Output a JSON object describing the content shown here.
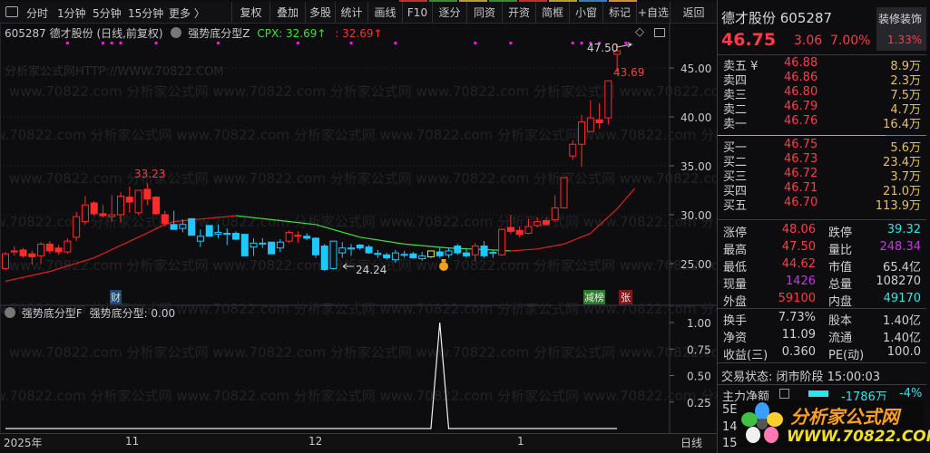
{
  "toolbar": {
    "tabs": [
      "分时",
      "1分钟",
      "5分钟",
      "15分钟",
      "更多 〉"
    ],
    "buttons": [
      "复权",
      "叠加",
      "多股",
      "统计",
      "画线",
      "F10",
      "逐分",
      "同资",
      "开资",
      "简框",
      "小窗",
      "标记",
      "+自选",
      "返回"
    ]
  },
  "chart_header": {
    "code_name": "605287 德才股份 (日线,前复权)",
    "indicator": "强势底分型Z",
    "cpx_label": "CPX: 32.69↑",
    "cpx_value": ": 32.69↑"
  },
  "watermark": {
    "main": "分析家公式网HTTP://WWW.70822.COM",
    "repeat": "www.70822.com 分析家公式网"
  },
  "price_axis": [
    "45.00",
    "40.00",
    "35.00",
    "30.00",
    "25.00"
  ],
  "price_ticks": [
    45,
    40,
    35,
    30,
    25
  ],
  "annotations": {
    "high_label": "33.23",
    "low_label": "24.24",
    "peak_label": "47.50",
    "close_label": "43.69"
  },
  "badges": {
    "cai": "财",
    "jianbang": "减榜",
    "zhang": "张"
  },
  "indicator_panel": {
    "label": "强势底分型F",
    "value_label": "强势底分型: 0.00",
    "axis": [
      "1.00",
      "0.75",
      "0.50",
      "0.25"
    ],
    "axis_values": [
      1,
      0.75,
      0.5,
      0.25
    ],
    "values_signal_index": 49
  },
  "date_axis": {
    "year": "2025年",
    "m11": "11",
    "m12": "12",
    "m1": "1",
    "period": "日线"
  },
  "colors": {
    "up": "#ff2a2a",
    "down": "#1ec8ff",
    "ma_up": "#e02020",
    "ma_down": "#3ee03e",
    "marker": "#e020e0"
  },
  "candles": [
    [
      24.5,
      26.2,
      24.3,
      26.0,
      "r"
    ],
    [
      26.3,
      26.8,
      25.8,
      26.2,
      "R"
    ],
    [
      26.4,
      26.6,
      25.6,
      25.8,
      "R"
    ],
    [
      26.0,
      26.3,
      24.9,
      25.7,
      "R"
    ],
    [
      25.8,
      27.2,
      25.0,
      27.0,
      "r"
    ],
    [
      27.0,
      27.3,
      26.0,
      26.3,
      "R"
    ],
    [
      26.6,
      26.9,
      25.9,
      26.2,
      "R"
    ],
    [
      26.2,
      27.6,
      26.0,
      27.3,
      "r"
    ],
    [
      27.7,
      30.3,
      27.3,
      29.8,
      "r"
    ],
    [
      29.3,
      31.9,
      29.0,
      31.0,
      "r"
    ],
    [
      31.2,
      31.4,
      29.9,
      30.1,
      "R"
    ],
    [
      30.1,
      31.0,
      29.7,
      29.9,
      "R"
    ],
    [
      29.8,
      32.0,
      29.3,
      30.0,
      "r"
    ],
    [
      30.0,
      32.3,
      29.2,
      31.9,
      "r"
    ],
    [
      31.8,
      32.9,
      30.2,
      31.3,
      "R"
    ],
    [
      30.2,
      32.5,
      30.0,
      32.5,
      "r"
    ],
    [
      32.6,
      33.23,
      31.0,
      31.6,
      "R"
    ],
    [
      31.8,
      31.9,
      30.0,
      30.1,
      "R"
    ],
    [
      30.0,
      30.4,
      28.8,
      29.1,
      "R"
    ],
    [
      29.0,
      30.4,
      28.7,
      28.5,
      "b"
    ],
    [
      28.6,
      29.5,
      28.2,
      29.0,
      "B"
    ],
    [
      29.6,
      29.6,
      27.9,
      27.9,
      "b"
    ],
    [
      27.3,
      28.5,
      26.7,
      27.8,
      "B"
    ],
    [
      28.9,
      28.9,
      27.8,
      27.8,
      "b"
    ],
    [
      28.0,
      29.0,
      27.6,
      28.2,
      "B"
    ],
    [
      28.0,
      28.6,
      26.9,
      28.1,
      "B"
    ],
    [
      28.1,
      28.3,
      27.4,
      27.5,
      "b"
    ],
    [
      28.0,
      28.0,
      25.8,
      25.8,
      "b"
    ],
    [
      26.7,
      27.6,
      25.8,
      27.1,
      "B"
    ],
    [
      27.0,
      27.6,
      26.6,
      27.1,
      "B"
    ],
    [
      27.2,
      27.2,
      26.0,
      26.0,
      "b"
    ],
    [
      26.6,
      27.5,
      26.2,
      27.2,
      "B"
    ],
    [
      27.3,
      28.4,
      27.1,
      28.2,
      "r"
    ],
    [
      27.9,
      28.3,
      27.1,
      27.8,
      "R"
    ],
    [
      27.8,
      28.1,
      27.4,
      27.6,
      "b"
    ],
    [
      27.6,
      27.7,
      25.6,
      25.9,
      "b"
    ],
    [
      26.8,
      27.0,
      24.24,
      24.4,
      "b"
    ],
    [
      24.5,
      27.3,
      24.4,
      27.3,
      "B"
    ],
    [
      26.1,
      27.2,
      25.6,
      26.6,
      "B"
    ],
    [
      26.5,
      27.0,
      25.8,
      26.6,
      "B"
    ],
    [
      26.9,
      27.0,
      26.4,
      26.6,
      "b"
    ],
    [
      26.7,
      26.9,
      26.0,
      26.1,
      "b"
    ],
    [
      25.95,
      26.4,
      25.6,
      26.05,
      "B"
    ],
    [
      25.9,
      26.1,
      25.4,
      25.6,
      "b"
    ],
    [
      25.4,
      26.4,
      25.1,
      26.1,
      "B"
    ],
    [
      25.85,
      26.3,
      25.6,
      25.95,
      "B"
    ],
    [
      26.0,
      26.2,
      25.5,
      25.6,
      "b"
    ],
    [
      25.5,
      26.2,
      25.3,
      25.8,
      "B"
    ],
    [
      25.7,
      26.3,
      25.6,
      26.3,
      "Y"
    ],
    [
      26.2,
      26.7,
      25.6,
      25.8,
      "b"
    ],
    [
      25.9,
      26.6,
      25.6,
      26.3,
      "B"
    ],
    [
      26.8,
      27.0,
      25.9,
      26.1,
      "b"
    ],
    [
      26.1,
      26.6,
      25.6,
      25.8,
      "b"
    ],
    [
      25.9,
      27.1,
      25.3,
      26.8,
      "r"
    ],
    [
      26.8,
      27.3,
      25.6,
      25.8,
      "b"
    ],
    [
      26.05,
      26.4,
      25.6,
      26.15,
      "B"
    ],
    [
      25.9,
      28.6,
      25.8,
      28.5,
      "r"
    ],
    [
      28.7,
      30.0,
      28.0,
      28.3,
      "R"
    ],
    [
      28.4,
      28.8,
      27.7,
      28.0,
      "R"
    ],
    [
      28.1,
      29.6,
      28.0,
      28.8,
      "r"
    ],
    [
      28.9,
      29.7,
      28.7,
      29.3,
      "r"
    ],
    [
      29.4,
      29.7,
      28.9,
      29.0,
      "R"
    ],
    [
      29.5,
      32.0,
      29.3,
      30.7,
      "r"
    ],
    [
      30.7,
      33.8,
      30.7,
      33.8,
      "r"
    ],
    [
      36.0,
      37.6,
      35.6,
      37.2,
      "r"
    ],
    [
      37.2,
      40.2,
      34.9,
      39.5,
      "r"
    ],
    [
      38.5,
      41.7,
      38.5,
      39.9,
      "r"
    ],
    [
      39.7,
      41.4,
      38.8,
      39.4,
      "R"
    ],
    [
      39.9,
      43.69,
      39.2,
      43.69,
      "r"
    ],
    [
      46.4,
      47.5,
      44.62,
      46.75,
      "r"
    ]
  ],
  "ma_points": [
    [
      0,
      23.2
    ],
    [
      5,
      24.2
    ],
    [
      10,
      25.6
    ],
    [
      15,
      27.7
    ],
    [
      18,
      29.0
    ],
    [
      19,
      29.3
    ],
    [
      26,
      29.9
    ],
    [
      30,
      29.5
    ],
    [
      35,
      29.0
    ],
    [
      40,
      27.7
    ],
    [
      45,
      27.0
    ],
    [
      50,
      26.6
    ],
    [
      55,
      26.4
    ],
    [
      57,
      26.3
    ],
    [
      60,
      26.5
    ],
    [
      63,
      27.0
    ],
    [
      66,
      28.1
    ],
    [
      69,
      30.6
    ],
    [
      71,
      32.7
    ]
  ],
  "ma_turns": [
    26,
    57
  ],
  "marker_indices": [
    7,
    11,
    12,
    13,
    17,
    24,
    33,
    39,
    44,
    53,
    57,
    64,
    65,
    66,
    67,
    70
  ],
  "quote": {
    "name_code": "德才股份 605287",
    "sector": "装修装饰",
    "sector_pct": "1.33%",
    "price": "46.75",
    "change": "3.06",
    "pct": "7.00%",
    "asks": [
      {
        "label": "卖五 ¥",
        "price": "46.88",
        "vol": "8.9万"
      },
      {
        "label": "卖四",
        "price": "46.86",
        "vol": "2.3万"
      },
      {
        "label": "卖三",
        "price": "46.80",
        "vol": "7.5万"
      },
      {
        "label": "卖二",
        "price": "46.79",
        "vol": "4.7万"
      },
      {
        "label": "卖一",
        "price": "46.76",
        "vol": "16.4万"
      }
    ],
    "bids": [
      {
        "label": "买一",
        "price": "46.75",
        "vol": "5.6万"
      },
      {
        "label": "买二",
        "price": "46.73",
        "vol": "23.4万"
      },
      {
        "label": "买三",
        "price": "46.72",
        "vol": "3.7万"
      },
      {
        "label": "买四",
        "price": "46.71",
        "vol": "21.0万"
      },
      {
        "label": "买五",
        "price": "46.70",
        "vol": "113.9万"
      }
    ],
    "stats": [
      {
        "l1": "涨停",
        "v1": "48.06",
        "c1": "red",
        "l2": "跌停",
        "v2": "39.32",
        "c2": "cyan"
      },
      {
        "l1": "最高",
        "v1": "47.50",
        "c1": "red",
        "l2": "量比",
        "v2": "248.34",
        "c2": "mag"
      },
      {
        "l1": "最低",
        "v1": "44.62",
        "c1": "red",
        "l2": "市值",
        "v2": "65.4亿",
        "c2": "wht"
      },
      {
        "l1": "现量",
        "v1": "1426",
        "c1": "mag",
        "l2": "总量",
        "v2": "108270",
        "c2": "wht"
      },
      {
        "l1": "外盘",
        "v1": "59100",
        "c1": "red",
        "l2": "内盘",
        "v2": "49170",
        "c2": "cyan"
      }
    ],
    "fund": [
      {
        "l1": "换手",
        "v1": "7.73%",
        "l2": "股本",
        "v2": "1.40亿"
      },
      {
        "l1": "净资",
        "v1": "11.09",
        "l2": "流通",
        "v2": "1.40亿"
      },
      {
        "l1": "收益(三)",
        "v1": "0.360",
        "l2": "PE(动)",
        "v2": "100.0"
      }
    ],
    "status": "交易状态: 闭市阶段 15:00:03",
    "main_flow": {
      "label": "主力净额",
      "value": "-1786万",
      "pct": "-4%"
    },
    "rows_partial": [
      "5E",
      "14:",
      "15:"
    ]
  },
  "logo": {
    "text": "分析家公式网",
    "url": "WWW.70822.COM"
  }
}
